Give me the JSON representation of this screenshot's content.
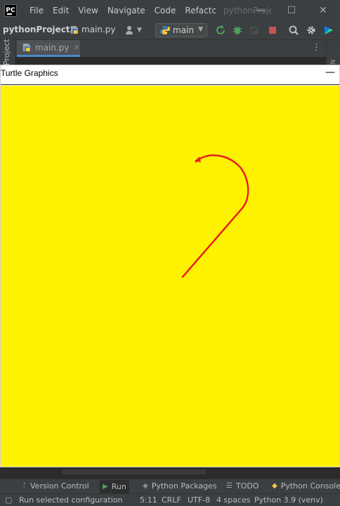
{
  "menubar": {
    "logo": "PC",
    "items": [
      "File",
      "Edit",
      "View",
      "Navigate",
      "Code",
      "Refactc"
    ],
    "window_title": "pythonProjec",
    "controls": {
      "minimize": "—",
      "maximize": "☐",
      "close": "✕"
    }
  },
  "navbar": {
    "project": "pythonProject3",
    "file": "main.py",
    "run_config": "main"
  },
  "tabs": {
    "project_strip": "Project",
    "active_tab": "main.py",
    "close": "✕",
    "menu": "⋮",
    "right_strip": "N"
  },
  "turtle": {
    "title": "Turtle Graphics",
    "minimize": "—",
    "background_color": "#fff200",
    "pen_color": "#e8211c"
  },
  "toolwindows": {
    "version_control": "Version Control",
    "run": "Run",
    "python_packages": "Python Packages",
    "todo": "TODO",
    "python_console": "Python Console"
  },
  "statusbar": {
    "message": "Run selected configuration",
    "position": "5:11",
    "line_sep": "CRLF",
    "encoding": "UTF-8",
    "indent": "4 spaces",
    "interpreter": "Python 3.9 (venv)"
  }
}
